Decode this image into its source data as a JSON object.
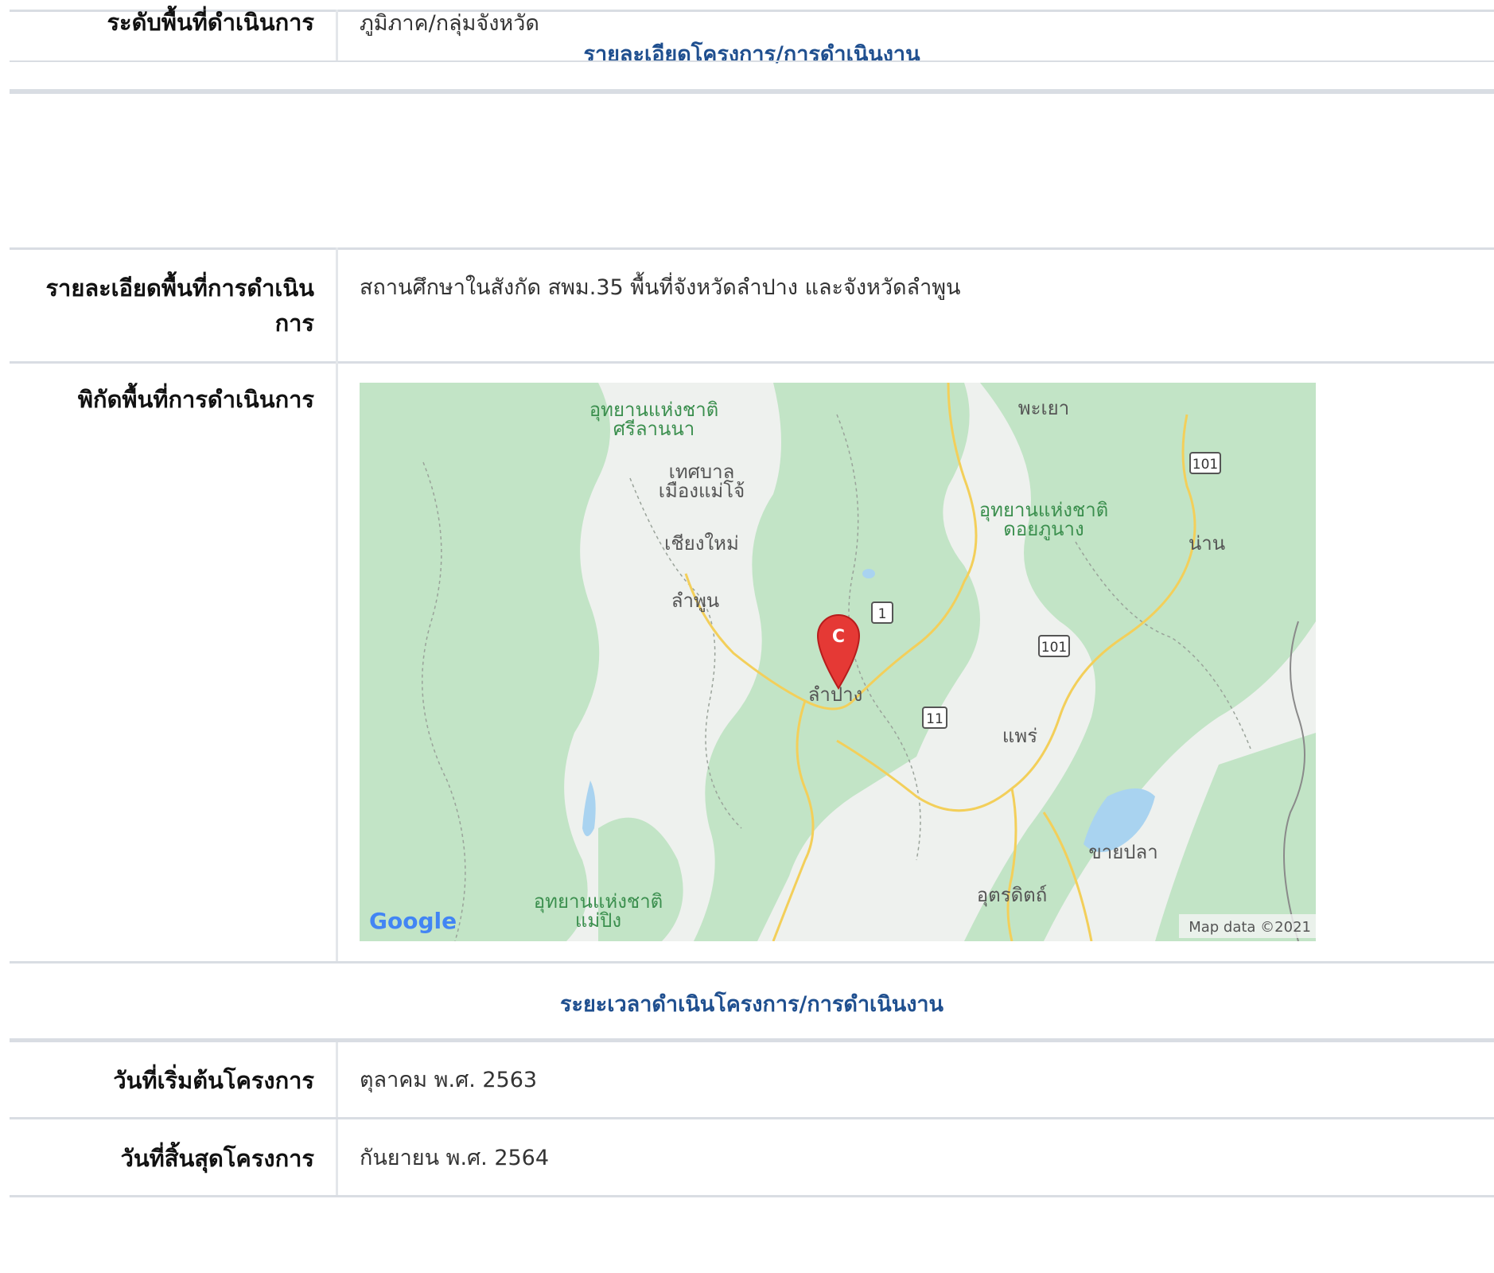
{
  "rows": {
    "area_level": {
      "label": "ระดับพื้นที่ดำเนินการ",
      "value": "ภูมิภาค/กลุ่มจังหวัด"
    },
    "area_detail": {
      "label": "รายละเอียดพื้นที่การดำเนินการ",
      "value": "สถานศึกษาในสังกัด สพม.35 พื้นที่จังหวัดลำปาง และจังหวัดลำพูน"
    },
    "coordinates": {
      "label": "พิกัดพื้นที่การดำเนินการ"
    },
    "start_date": {
      "label": "วันที่เริ่มต้นโครงการ",
      "value": "ตุลาคม พ.ศ. 2563"
    },
    "end_date": {
      "label": "วันที่สิ้นสุดโครงการ",
      "value": "กันยายน พ.ศ. 2564"
    }
  },
  "sections": {
    "project_details": "รายละเอียดโครงการ/การดำเนินงาน",
    "project_period": "ระยะเวลาดำเนินโครงการ/การดำเนินงาน"
  },
  "map": {
    "marker_letter": "C",
    "google_logo": "Google",
    "attribution": "Map data ©2021",
    "places": {
      "park_srilanna_1": "อุทยานแห่งชาติ",
      "park_srilanna_2": "ศรีลานนา",
      "phayao": "พะเยา",
      "maejo_1": "เทศบาล",
      "maejo_2": "เมืองแม่โจ้",
      "doiphunang_1": "อุทยานแห่งชาติ",
      "doiphunang_2": "ดอยภูนาง",
      "chiangmai": "เชียงใหม่",
      "nan": "น่าน",
      "lamphun": "ลำพูน",
      "lampang": "ลำปาง",
      "phrae": "แพร่",
      "khaipla": "ขายปลา",
      "maeping_1": "อุทยานแห่งชาติ",
      "maeping_2": "แม่ปิง",
      "uttaradit": "อุตรดิตถ์"
    },
    "routes": {
      "r101_a": "101",
      "r101_b": "101",
      "r1": "1",
      "r11": "11"
    },
    "colors": {
      "forest": "#bfe3c4",
      "land": "#f1f1f1",
      "road": "#f3cf5a",
      "water": "#a9d3f0",
      "marker": "#e53935"
    }
  }
}
